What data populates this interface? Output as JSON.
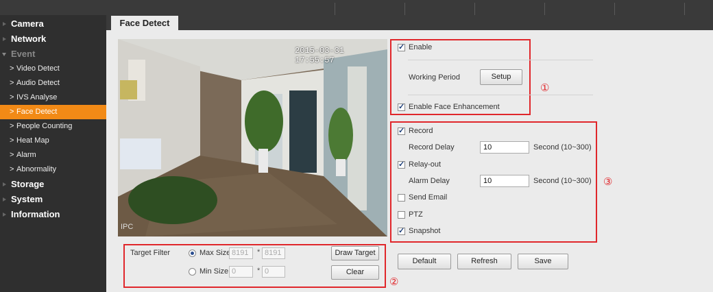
{
  "sidebar": {
    "items": [
      {
        "label": "Camera"
      },
      {
        "label": "Network"
      },
      {
        "label": "Event"
      },
      {
        "label": "Storage"
      },
      {
        "label": "System"
      },
      {
        "label": "Information"
      }
    ],
    "event_sub": [
      {
        "label": "Video Detect"
      },
      {
        "label": "Audio Detect"
      },
      {
        "label": "IVS Analyse"
      },
      {
        "label": "Face Detect"
      },
      {
        "label": "People Counting"
      },
      {
        "label": "Heat Map"
      },
      {
        "label": "Alarm"
      },
      {
        "label": "Abnormality"
      }
    ]
  },
  "tab": {
    "label": "Face Detect"
  },
  "video": {
    "timestamp": "2015-03-31 17:55:57",
    "overlay": "IPC"
  },
  "target_filter": {
    "label": "Target Filter",
    "max_label": "Max Size",
    "max_w": "8191",
    "max_h": "8191",
    "min_label": "Min Size",
    "min_w": "0",
    "min_h": "0",
    "times": "*",
    "draw_target": "Draw Target",
    "clear": "Clear",
    "selected": "max"
  },
  "settings": {
    "enable": {
      "label": "Enable",
      "checked": true
    },
    "working_period": {
      "label": "Working Period",
      "button": "Setup"
    },
    "face_enhancement": {
      "label": "Enable Face Enhancement",
      "checked": true
    },
    "record": {
      "label": "Record",
      "checked": true
    },
    "record_delay": {
      "label": "Record Delay",
      "value": "10",
      "unit": "Second (10~300)"
    },
    "relay_out": {
      "label": "Relay-out",
      "checked": true
    },
    "alarm_delay": {
      "label": "Alarm Delay",
      "value": "10",
      "unit": "Second (10~300)"
    },
    "send_email": {
      "label": "Send Email",
      "checked": false
    },
    "ptz": {
      "label": "PTZ",
      "checked": false
    },
    "snapshot": {
      "label": "Snapshot",
      "checked": true
    }
  },
  "actions": {
    "default": "Default",
    "refresh": "Refresh",
    "save": "Save"
  },
  "markers": {
    "m1": "①",
    "m2": "②",
    "m3": "③"
  },
  "colors": {
    "accent": "#f28a16",
    "annotation": "#e0262a",
    "sidebar": "#2f2f2f"
  }
}
